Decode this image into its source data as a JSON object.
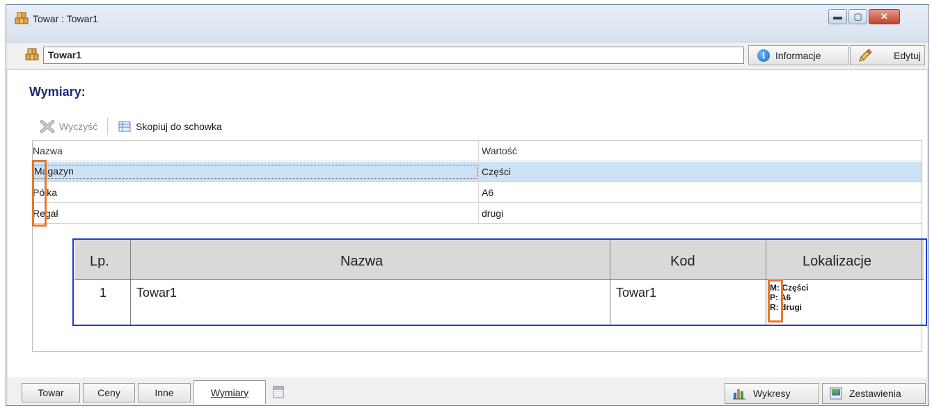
{
  "window": {
    "title": "Towar : Towar1",
    "controls": {
      "minimize": "▬",
      "maximize": "▢",
      "close": "✕"
    }
  },
  "header": {
    "name_value": "Towar1",
    "info_label": "Informacje",
    "edit_label": "Edytuj",
    "info_glyph": "i"
  },
  "section": {
    "title": "Wymiary:"
  },
  "toolbar": {
    "clear_label": "Wyczyść",
    "copy_label": "Skopiuj do schowka"
  },
  "grid": {
    "columns": [
      "Nazwa",
      "Wartość"
    ],
    "rows": [
      {
        "name": "Magazyn",
        "value": "Części",
        "selected": true
      },
      {
        "name": "Półka",
        "value": "A6",
        "selected": false
      },
      {
        "name": "Regał",
        "value": "drugi",
        "selected": false
      }
    ]
  },
  "report": {
    "columns": [
      "Lp.",
      "Nazwa",
      "Kod",
      "Lokalizacje"
    ],
    "row": {
      "lp": "1",
      "name": "Towar1",
      "code": "Towar1",
      "locations": [
        {
          "key": "M:",
          "value": "Części"
        },
        {
          "key": "P:",
          "value": "A6"
        },
        {
          "key": "R:",
          "value": "drugi"
        }
      ]
    }
  },
  "tabs": [
    "Towar",
    "Ceny",
    "Inne",
    "Wymiary"
  ],
  "active_tab": "Wymiary",
  "bottom_buttons": {
    "charts": "Wykresy",
    "reports": "Zestawienia"
  },
  "colors": {
    "highlight_orange": "#e6792e",
    "highlight_blue": "#1840d0",
    "selection": "#cde3f5",
    "section_title": "#1d2a7a"
  },
  "icons": [
    "towar-icon",
    "info-icon",
    "pencil-icon",
    "clear-x-icon",
    "clipboard-icon",
    "calendar-icon",
    "bar-chart-icon",
    "report-icon"
  ]
}
